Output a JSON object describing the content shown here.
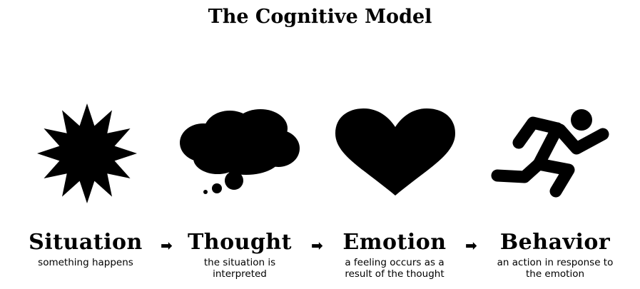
{
  "title": "The Cognitive Model",
  "stages": [
    {
      "name": "Situation",
      "desc": [
        "something happens"
      ],
      "icon": "starburst-icon"
    },
    {
      "name": "Thought",
      "desc": [
        "the situation is",
        "interpreted"
      ],
      "icon": "thought-cloud-icon"
    },
    {
      "name": "Emotion",
      "desc": [
        "a feeling occurs as a",
        "result of the thought"
      ],
      "icon": "heart-icon"
    },
    {
      "name": "Behavior",
      "desc": [
        "an action in response to",
        "the emotion"
      ],
      "icon": "running-person-icon"
    }
  ],
  "arrow_glyph": "➡",
  "colors": {
    "foreground": "#000000",
    "background": "#ffffff"
  }
}
